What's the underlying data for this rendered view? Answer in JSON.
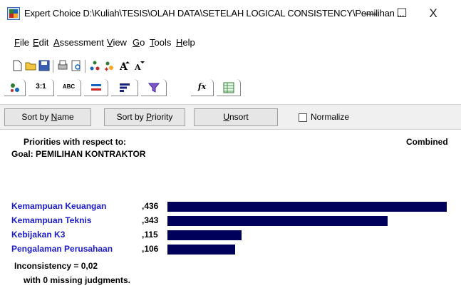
{
  "window": {
    "title": "Expert Choice    D:\\Kuliah\\TESIS\\OLAH DATA\\SETELAH LOGICAL CONSISTENCY\\Pemilihan ...",
    "minimize_glyph": "—",
    "maximize_glyph": "☐",
    "close_glyph": "X"
  },
  "menu": [
    {
      "label": "File",
      "ul": "F",
      "rest": "ile"
    },
    {
      "label": "Edit",
      "ul": "E",
      "rest": "dit"
    },
    {
      "label": "Assessment",
      "ul": "A",
      "rest": "ssessment"
    },
    {
      "label": "View",
      "ul": "V",
      "rest": "iew"
    },
    {
      "label": "Go",
      "ul": "G",
      "rest": "o"
    },
    {
      "label": "Tools",
      "ul": "T",
      "rest": "ools"
    },
    {
      "label": "Help",
      "ul": "H",
      "rest": "elp"
    }
  ],
  "toolbar_icons": [
    "new-file-icon",
    "open-folder-icon",
    "save-icon",
    "print-icon",
    "print-preview-icon",
    "node-icon",
    "node-add-icon",
    "font-larger-icon",
    "font-smaller-icon"
  ],
  "tabs": [
    {
      "icon": "hierarchy-icon",
      "label": ""
    },
    {
      "icon": "pairwise-numeric-icon",
      "label": "3:1"
    },
    {
      "icon": "verbal-icon",
      "label": "ABC"
    },
    {
      "icon": "graphical-icon",
      "label": ""
    },
    {
      "icon": "priorities-icon",
      "label": ""
    },
    {
      "icon": "funnel-icon",
      "label": ""
    },
    {
      "icon": "formula-icon",
      "label": "fx"
    },
    {
      "icon": "data-grid-icon",
      "label": ""
    }
  ],
  "sort_buttons": {
    "by_name": {
      "pre": "Sort by ",
      "ul": "N",
      "post": "ame"
    },
    "by_priority": {
      "pre": "Sort by ",
      "ul": "P",
      "post": "riority"
    },
    "unsort": {
      "pre": "",
      "ul": "U",
      "post": "nsort"
    }
  },
  "normalize": {
    "label": "Normalize",
    "checked": false
  },
  "results": {
    "header": "Priorities with respect to:",
    "goal": "Goal: PEMILIHAN KONTRAKTOR",
    "combined_label": "Combined",
    "criteria": [
      {
        "name": "Kemampuan Keuangan",
        "value": ",436",
        "priority": 0.436
      },
      {
        "name": "Kemampuan Teknis",
        "value": ",343",
        "priority": 0.343
      },
      {
        "name": "Kebijakan K3",
        "value": ",115",
        "priority": 0.115
      },
      {
        "name": "Pengalaman Perusahaan",
        "value": ",106",
        "priority": 0.106
      }
    ],
    "inconsistency": "Inconsistency = 0,02",
    "missing": "with 0  missing judgments.",
    "bar_color": "#00005a"
  }
}
